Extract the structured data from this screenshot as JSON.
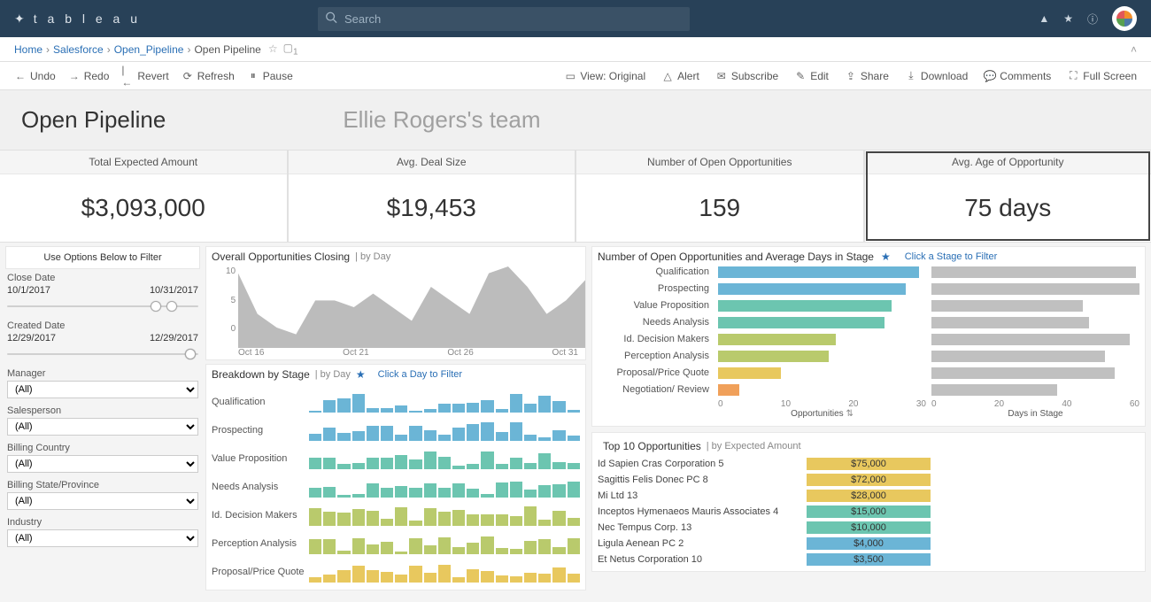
{
  "brand": "t a b l e a u",
  "search": {
    "placeholder": "Search"
  },
  "top_icons": {
    "alert": "alert-icon",
    "star": "star-icon",
    "info": "info-icon"
  },
  "breadcrumb": [
    {
      "label": "Home",
      "link": true
    },
    {
      "label": "Salesforce",
      "link": true
    },
    {
      "label": "Open_Pipeline",
      "link": true
    },
    {
      "label": "Open Pipeline",
      "link": false
    }
  ],
  "view_badge": "1",
  "toolbar_left": {
    "undo": "Undo",
    "redo": "Redo",
    "revert": "Revert",
    "refresh": "Refresh",
    "pause": "Pause"
  },
  "toolbar_right": {
    "view": "View: Original",
    "alert": "Alert",
    "subscribe": "Subscribe",
    "edit": "Edit",
    "share": "Share",
    "download": "Download",
    "comments": "Comments",
    "fullscreen": "Full Screen"
  },
  "page": {
    "title": "Open Pipeline",
    "team": "Ellie Rogers's team"
  },
  "kpis": [
    {
      "label": "Total Expected Amount",
      "value": "$3,093,000"
    },
    {
      "label": "Avg. Deal Size",
      "value": "$19,453"
    },
    {
      "label": "Number of Open Opportunities",
      "value": "159"
    },
    {
      "label": "Avg. Age of Opportunity",
      "value": "75 days",
      "selected": true
    }
  ],
  "filters": {
    "title": "Use Options Below to Filter",
    "close_date": {
      "label": "Close Date",
      "from": "10/1/2017",
      "to": "10/31/2017",
      "lo": 0.78,
      "hi": 0.86
    },
    "created_date": {
      "label": "Created Date",
      "from": "12/29/2017",
      "to": "12/29/2017",
      "lo": 0.96,
      "hi": 0.96
    },
    "dropdowns": [
      {
        "label": "Manager",
        "value": "(All)"
      },
      {
        "label": "Salesperson",
        "value": "(All)"
      },
      {
        "label": "Billing Country",
        "value": "(All)"
      },
      {
        "label": "Billing State/Province",
        "value": "(All)"
      },
      {
        "label": "Industry",
        "value": "(All)"
      }
    ]
  },
  "middle": {
    "overall": {
      "title": "Overall Opportunities Closing",
      "sub": "| by Day",
      "y_ticks": [
        "10",
        "5",
        "0"
      ],
      "x_ticks": [
        "Oct 16",
        "Oct 21",
        "Oct 26",
        "Oct 31"
      ]
    },
    "breakdown": {
      "title": "Breakdown by Stage",
      "sub": "| by Day",
      "hint": "Click a Day to Filter",
      "stages": [
        {
          "label": "Qualification",
          "color": "c-blue"
        },
        {
          "label": "Prospecting",
          "color": "c-blue"
        },
        {
          "label": "Value Proposition",
          "color": "c-teal"
        },
        {
          "label": "Needs Analysis",
          "color": "c-teal"
        },
        {
          "label": "Id. Decision Makers",
          "color": "c-olive"
        },
        {
          "label": "Perception Analysis",
          "color": "c-olive"
        },
        {
          "label": "Proposal/Price Quote",
          "color": "c-yellow"
        }
      ]
    }
  },
  "right": {
    "oppstage": {
      "title": "Number of Open Opportunities and Average Days in Stage",
      "hint": "Click a Stage to Filter",
      "rows": [
        {
          "label": "Qualification",
          "opp": 29,
          "days": 65,
          "color": "c-blue"
        },
        {
          "label": "Prospecting",
          "opp": 27,
          "days": 66,
          "color": "c-blue"
        },
        {
          "label": "Value Proposition",
          "opp": 25,
          "days": 48,
          "color": "c-teal"
        },
        {
          "label": "Needs Analysis",
          "opp": 24,
          "days": 50,
          "color": "c-teal"
        },
        {
          "label": "Id. Decision Makers",
          "opp": 17,
          "days": 63,
          "color": "c-olive"
        },
        {
          "label": "Perception Analysis",
          "opp": 16,
          "days": 55,
          "color": "c-olive"
        },
        {
          "label": "Proposal/Price Quote",
          "opp": 9,
          "days": 58,
          "color": "c-yellow"
        },
        {
          "label": "Negotiation/ Review",
          "opp": 3,
          "days": 40,
          "color": "c-orange"
        }
      ],
      "opp_axis": {
        "ticks": [
          "0",
          "10",
          "20",
          "30"
        ],
        "title": "Opportunities",
        "max": 30
      },
      "days_axis": {
        "ticks": [
          "0",
          "20",
          "40",
          "60"
        ],
        "title": "Days in Stage",
        "max": 66
      }
    },
    "top10": {
      "title": "Top 10 Opportunities",
      "sub": "| by Expected Amount",
      "rows": [
        {
          "name": "Id Sapien Cras Corporation 5",
          "value": "$75,000",
          "color": "c-yellow"
        },
        {
          "name": "Sagittis Felis Donec PC 8",
          "value": "$72,000",
          "color": "c-yellow"
        },
        {
          "name": "Mi Ltd 13",
          "value": "$28,000",
          "color": "c-yellow"
        },
        {
          "name": "Inceptos Hymenaeos Mauris Associates 4",
          "value": "$15,000",
          "color": "c-teal"
        },
        {
          "name": "Nec Tempus Corp. 13",
          "value": "$10,000",
          "color": "c-teal"
        },
        {
          "name": "Ligula Aenean PC 2",
          "value": "$4,000",
          "color": "c-blue"
        },
        {
          "name": "Et Netus Corporation 10",
          "value": "$3,500",
          "color": "c-blue"
        }
      ]
    }
  },
  "chart_data": [
    {
      "type": "area",
      "title": "Overall Opportunities Closing by Day",
      "x": [
        "Oct 13",
        "Oct 14",
        "Oct 15",
        "Oct 16",
        "Oct 17",
        "Oct 18",
        "Oct 19",
        "Oct 20",
        "Oct 21",
        "Oct 22",
        "Oct 23",
        "Oct 24",
        "Oct 25",
        "Oct 26",
        "Oct 27",
        "Oct 28",
        "Oct 29",
        "Oct 30",
        "Oct 31"
      ],
      "values": [
        11,
        5,
        3,
        2,
        7,
        7,
        6,
        8,
        6,
        4,
        9,
        7,
        5,
        11,
        12,
        9,
        5,
        7,
        10
      ],
      "ylim": [
        0,
        12
      ],
      "ylabel": "",
      "xlabel": ""
    },
    {
      "type": "bar",
      "title": "Number of Open Opportunities by Stage",
      "categories": [
        "Qualification",
        "Prospecting",
        "Value Proposition",
        "Needs Analysis",
        "Id. Decision Makers",
        "Perception Analysis",
        "Proposal/Price Quote",
        "Negotiation/ Review"
      ],
      "values": [
        29,
        27,
        25,
        24,
        17,
        16,
        9,
        3
      ],
      "xlabel": "Opportunities",
      "ylabel": "",
      "ylim": [
        0,
        30
      ]
    },
    {
      "type": "bar",
      "title": "Average Days in Stage",
      "categories": [
        "Qualification",
        "Prospecting",
        "Value Proposition",
        "Needs Analysis",
        "Id. Decision Makers",
        "Perception Analysis",
        "Proposal/Price Quote",
        "Negotiation/ Review"
      ],
      "values": [
        65,
        66,
        48,
        50,
        63,
        55,
        58,
        40
      ],
      "xlabel": "Days in Stage",
      "ylabel": "",
      "ylim": [
        0,
        66
      ]
    },
    {
      "type": "table",
      "title": "Top 10 Opportunities by Expected Amount",
      "columns": [
        "Opportunity",
        "Expected Amount"
      ],
      "rows": [
        [
          "Id Sapien Cras Corporation 5",
          "$75,000"
        ],
        [
          "Sagittis Felis Donec PC 8",
          "$72,000"
        ],
        [
          "Mi Ltd 13",
          "$28,000"
        ],
        [
          "Inceptos Hymenaeos Mauris Associates 4",
          "$15,000"
        ],
        [
          "Nec Tempus Corp. 13",
          "$10,000"
        ],
        [
          "Ligula Aenean PC 2",
          "$4,000"
        ],
        [
          "Et Netus Corporation 10",
          "$3,500"
        ]
      ]
    }
  ]
}
